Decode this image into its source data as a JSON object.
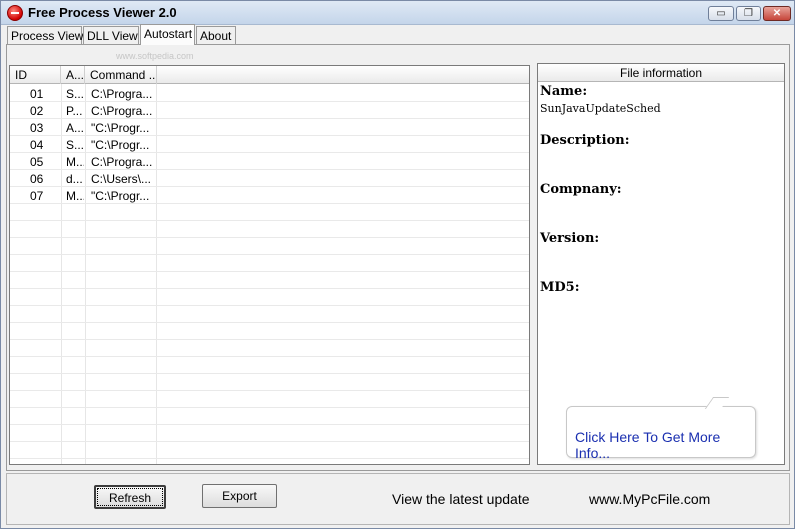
{
  "window": {
    "title": "Free Process Viewer 2.0",
    "controls": {
      "minimize": "▭",
      "maximize": "❐",
      "close": "✕"
    }
  },
  "tabs": [
    {
      "label": "Process View",
      "active": false
    },
    {
      "label": "DLL View",
      "active": false
    },
    {
      "label": "Autostart",
      "active": true
    },
    {
      "label": "About",
      "active": false
    }
  ],
  "watermark": "www.softpedia.com",
  "list": {
    "columns": [
      "ID",
      "A...",
      "Command ..."
    ],
    "rows": [
      {
        "id": "01",
        "a": "S...",
        "command": "C:\\Progra..."
      },
      {
        "id": "02",
        "a": "P...",
        "command": "C:\\Progra..."
      },
      {
        "id": "03",
        "a": "A...",
        "command": "\"C:\\Progr..."
      },
      {
        "id": "04",
        "a": "S...",
        "command": "\"C:\\Progr..."
      },
      {
        "id": "05",
        "a": "M...",
        "command": "C:\\Progra..."
      },
      {
        "id": "06",
        "a": "d...",
        "command": "C:\\Users\\..."
      },
      {
        "id": "07",
        "a": "M...",
        "command": "\"C:\\Progr..."
      }
    ]
  },
  "file_info": {
    "header": "File information",
    "name_label": "Name:",
    "name_value": "SunJavaUpdateSched",
    "description_label": "Description:",
    "company_label": "Compnany:",
    "version_label": "Version:",
    "md5_label": "MD5:",
    "more_info_link": "Click Here To Get More Info..."
  },
  "bottom": {
    "refresh_label": "Refresh",
    "export_label": "Export",
    "update_text": "View the latest update",
    "site_text": "www.MyPcFile.com"
  },
  "colors": {
    "link": "#1a2fb0",
    "close_button": "#c6453a"
  }
}
